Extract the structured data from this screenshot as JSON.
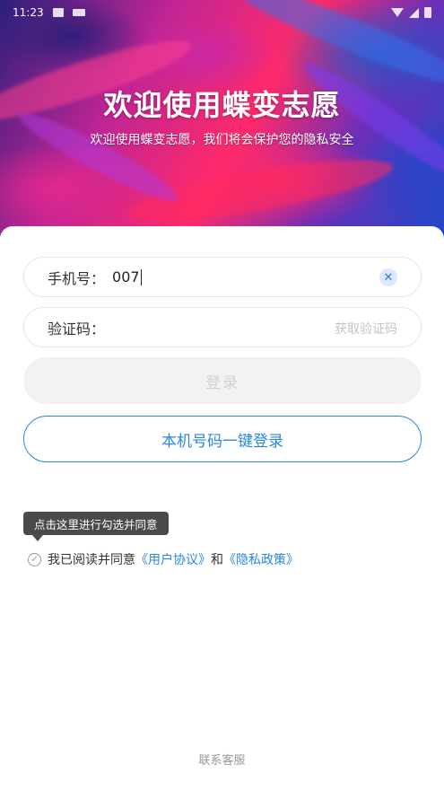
{
  "status_bar": {
    "time": "11:23"
  },
  "hero": {
    "title": "欢迎使用蝶变志愿",
    "subtitle": "欢迎使用蝶变志愿，我们将会保护您的隐私安全"
  },
  "form": {
    "phone_label": "手机号：",
    "phone_value": "007",
    "code_label": "验证码：",
    "get_code_label": "获取验证码",
    "login_label": "登录",
    "onekey_login_label": "本机号码一键登录"
  },
  "agreement": {
    "tooltip": "点击这里进行勾选并同意",
    "prefix": "我已阅读并同意",
    "user_agreement": "《用户协议》",
    "and": "和",
    "privacy_policy": "《隐私政策》"
  },
  "footer": {
    "contact_label": "联系客服"
  },
  "colors": {
    "accent": "#2a86e6",
    "disabled_bg": "#f2f2f2",
    "tooltip_bg": "#4a4a4a"
  }
}
